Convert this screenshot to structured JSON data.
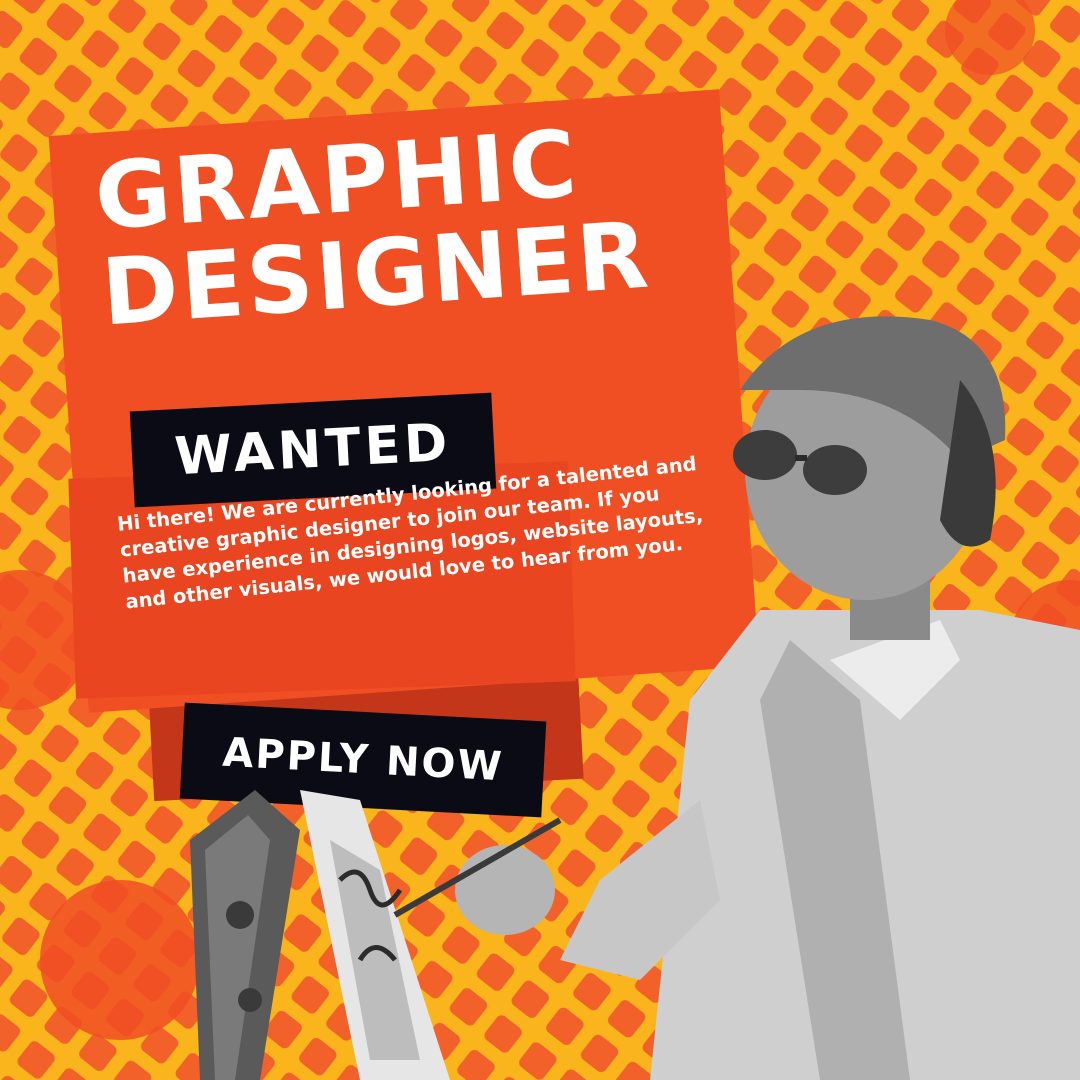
{
  "poster": {
    "headline_line1": "GRAPHIC",
    "headline_line2": "DESIGNER",
    "wanted_label": "WANTED",
    "description": "Hi there! We are currently looking for a talented and creative graphic designer to join our team. If you have experience in designing logos, website layouts, and other visuals, we would love to hear from you.",
    "cta_label": "APPLY NOW"
  },
  "colors": {
    "background_yellow": "#f9b51b",
    "grid_orange": "#f2612a",
    "card_orange": "#f04e23",
    "label_black": "#0b0b16",
    "text_white": "#ffffff"
  },
  "images": {
    "photo": "painter-woman-photo",
    "easel": "easel-with-canvas"
  }
}
